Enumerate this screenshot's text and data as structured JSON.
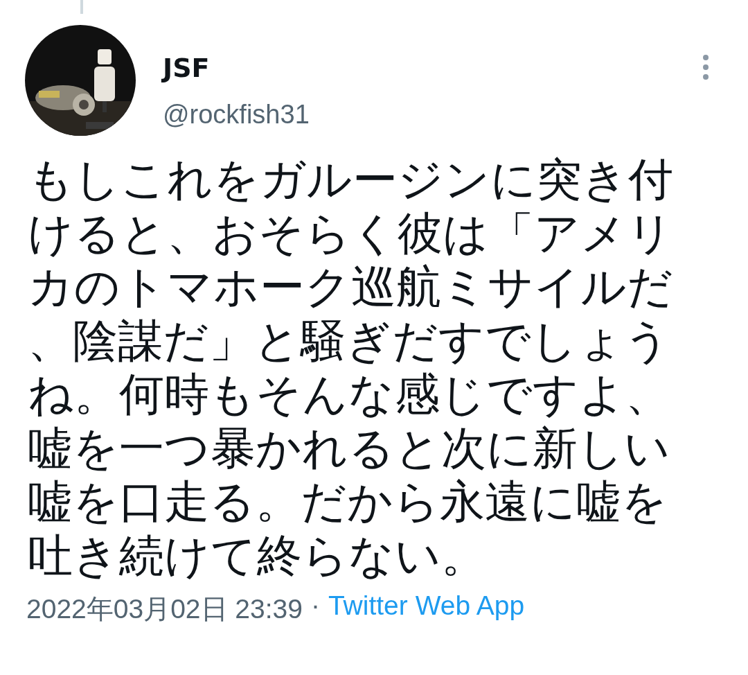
{
  "tweet": {
    "author": {
      "name": "JSF",
      "handle": "@rockfish31"
    },
    "text": "もしこれをガルージンに突き付けると、おそらく彼は「アメリカのトマホーク巡航ミサイルだ、陰謀だ」と騒ぎだすでしょうね。何時もそんな感じですよ、嘘を一つ暴かれると次に新しい嘘を口走る。だから永遠に嘘を吐き続けて終らない。",
    "timestamp": "2022年03月02日 23:39",
    "separator": "·",
    "source": "Twitter Web App"
  }
}
